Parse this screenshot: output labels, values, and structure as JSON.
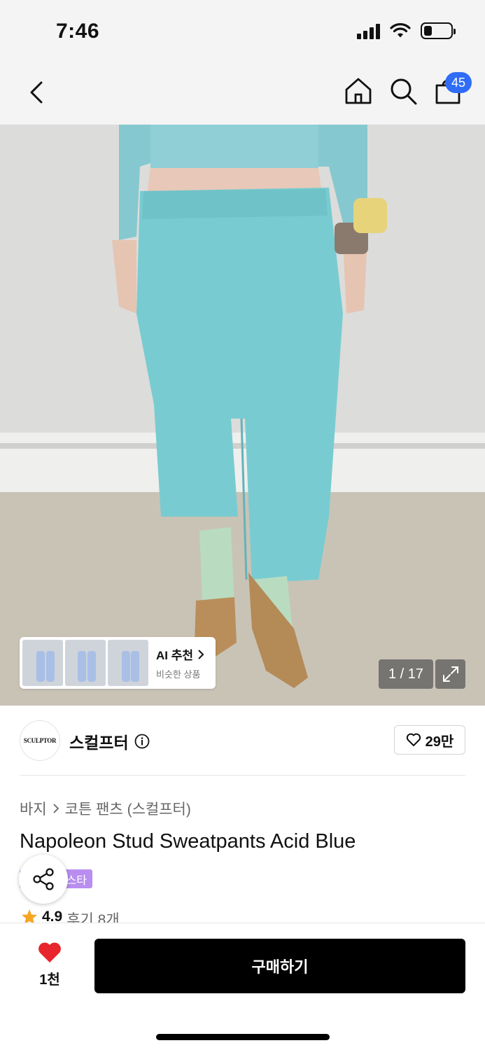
{
  "status_bar": {
    "time": "7:46",
    "battery_level": 0.3
  },
  "nav": {
    "back_icon": "chevron-left-icon",
    "home_icon": "home-icon",
    "search_icon": "search-icon",
    "bag_icon": "shopping-bag-icon",
    "bag_count": "45"
  },
  "gallery": {
    "counter": "1 / 17",
    "ai_recommend": {
      "title": "AI 추천",
      "subtitle": "비슷한 상품"
    }
  },
  "brand": {
    "logo_text": "SCULPTOR",
    "name": "스컬프터",
    "likes": "29만"
  },
  "product": {
    "breadcrumb": [
      "바지",
      "코튼 팬츠 (스컬프터)"
    ],
    "title": "Napoleon Stud Sweatpants Acid Blue",
    "tag": "스타",
    "rating": "4.9",
    "reviews": "후기 8개"
  },
  "bottom": {
    "wish_count": "1천",
    "buy_label": "구매하기"
  },
  "colors": {
    "accent_badge": "#2f6df6",
    "tag_purple": "#b98ef0",
    "heart_red": "#e8242c",
    "star": "#f5a623"
  }
}
